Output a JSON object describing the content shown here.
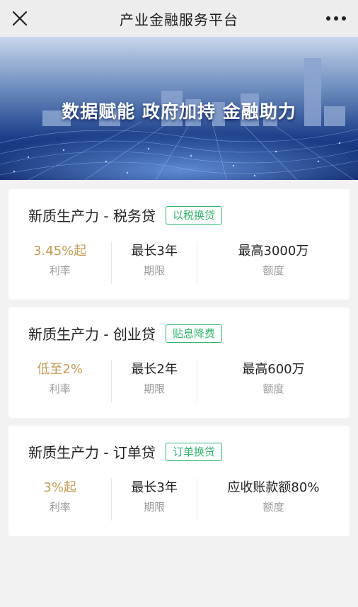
{
  "nav": {
    "title": "产业金融服务平台",
    "close_icon": "close-icon",
    "more_icon": "more-icon"
  },
  "banner": {
    "slogan": "数据赋能 政府加持 金融助力"
  },
  "products": [
    {
      "name": "新质生产力 - 税务贷",
      "tag": "以税换贷",
      "rate_value": "3.45%起",
      "rate_label": "利率",
      "term_value": "最长3年",
      "term_label": "期限",
      "amount_value": "最高3000万",
      "amount_label": "额度"
    },
    {
      "name": "新质生产力 - 创业贷",
      "tag": "贴息降费",
      "rate_value": "低至2%",
      "rate_label": "利率",
      "term_value": "最长2年",
      "term_label": "期限",
      "amount_value": "最高600万",
      "amount_label": "额度"
    },
    {
      "name": "新质生产力 - 订单贷",
      "tag": "订单换贷",
      "rate_value": "3%起",
      "rate_label": "利率",
      "term_value": "最长3年",
      "term_label": "期限",
      "amount_value": "应收账款额80%",
      "amount_label": "额度"
    }
  ],
  "colors": {
    "accent_green": "#2fb56a",
    "rate_gold": "#c49a55",
    "background": "#f2f2f2"
  }
}
